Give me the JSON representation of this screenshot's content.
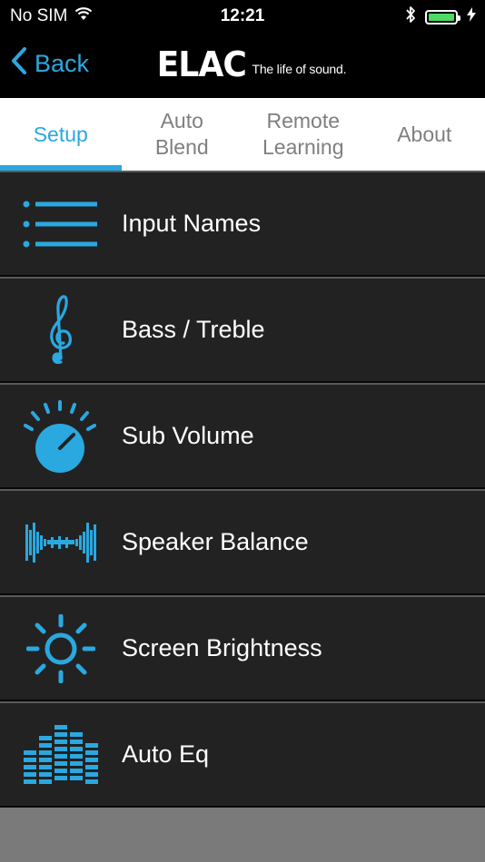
{
  "status_bar": {
    "carrier": "No SIM",
    "time": "12:21"
  },
  "nav": {
    "back_label": "Back",
    "logo_text": "ELAC",
    "logo_tagline": "The life of sound."
  },
  "tabs": [
    {
      "label": "Setup",
      "active": true
    },
    {
      "label": "Auto\nBlend",
      "active": false
    },
    {
      "label": "Remote\nLearning",
      "active": false
    },
    {
      "label": "About",
      "active": false
    }
  ],
  "menu": [
    {
      "label": "Input Names",
      "icon": "list-icon"
    },
    {
      "label": "Bass / Treble",
      "icon": "treble-clef-icon"
    },
    {
      "label": "Sub Volume",
      "icon": "volume-knob-icon"
    },
    {
      "label": "Speaker Balance",
      "icon": "waveform-icon"
    },
    {
      "label": "Screen Brightness",
      "icon": "sun-icon"
    },
    {
      "label": "Auto Eq",
      "icon": "equalizer-icon"
    }
  ],
  "colors": {
    "accent": "#2aa8e0",
    "row_bg": "#222222",
    "battery": "#4cd964"
  }
}
